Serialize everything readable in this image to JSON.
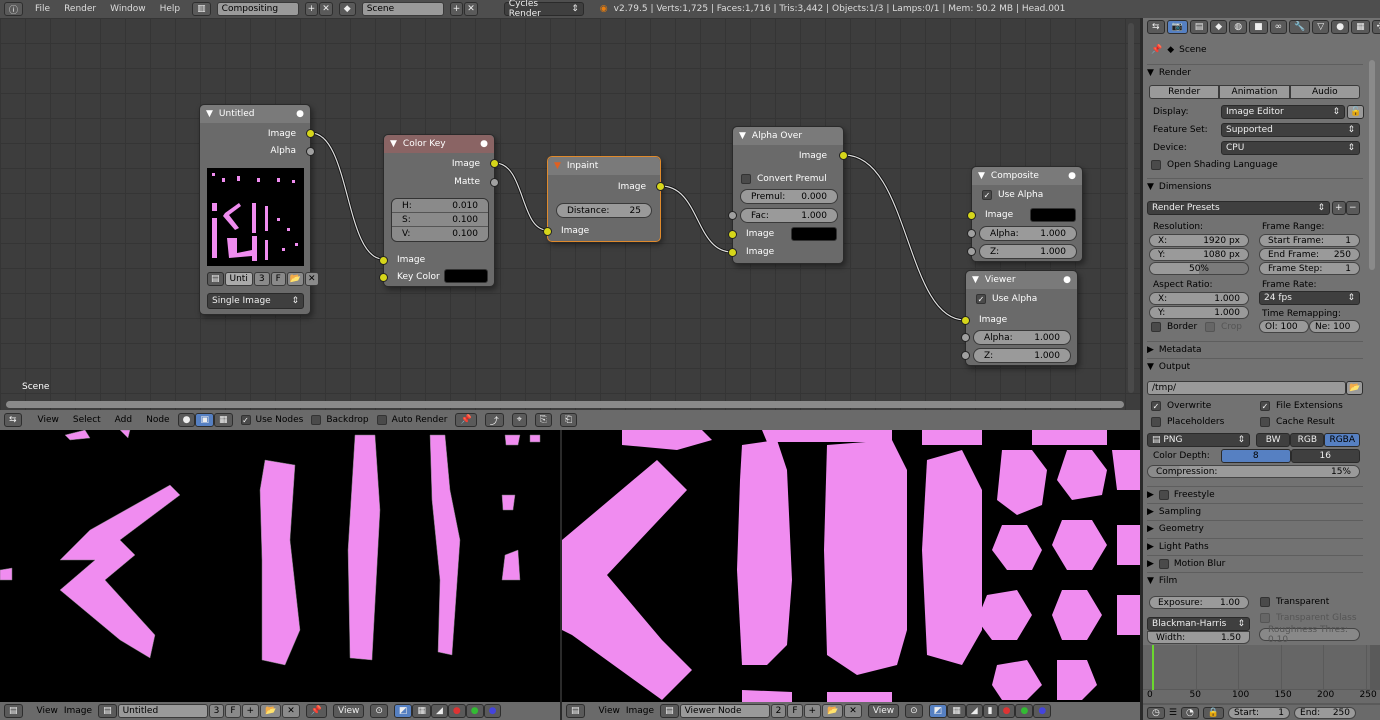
{
  "topbar": {
    "menus": [
      "File",
      "Render",
      "Window",
      "Help"
    ],
    "screen": "Compositing",
    "scene": "Scene",
    "engine": "Cycles Render",
    "stats": "v2.79.5 | Verts:1,725 | Faces:1,716 | Tris:3,442 | Objects:1/3 | Lamps:0/1 | Mem: 50.2 MB | Head.001"
  },
  "node_editor": {
    "scene_label": "Scene",
    "nodes": {
      "image": {
        "title": "Untitled",
        "out_image": "Image",
        "out_alpha": "Alpha",
        "image_name": "Unti",
        "users": "3",
        "fake": "F",
        "source": "Single Image"
      },
      "color_key": {
        "title": "Color Key",
        "out_image": "Image",
        "out_matte": "Matte",
        "h_label": "H:",
        "h": "0.010",
        "s_label": "S:",
        "s": "0.100",
        "v_label": "V:",
        "v": "0.100",
        "in_image": "Image",
        "in_key": "Key Color",
        "key_color": "#000000",
        "header_color": "#8a6464"
      },
      "inpaint": {
        "title": "Inpaint",
        "out_image": "Image",
        "distance_label": "Distance:",
        "distance": "25",
        "in_image": "Image",
        "border_color": "#e08a2c"
      },
      "alpha_over": {
        "title": "Alpha Over",
        "out_image": "Image",
        "convert_premul": "Convert Premul",
        "premul_label": "Premul:",
        "premul": "0.000",
        "fac_label": "Fac:",
        "fac": "1.000",
        "in_image1": "Image",
        "in_image2": "Image"
      },
      "composite": {
        "title": "Composite",
        "use_alpha": "Use Alpha",
        "in_image": "Image",
        "alpha_label": "Alpha:",
        "alpha": "1.000",
        "z_label": "Z:",
        "z": "1.000"
      },
      "viewer": {
        "title": "Viewer",
        "use_alpha": "Use Alpha",
        "in_image": "Image",
        "alpha_label": "Alpha:",
        "alpha": "1.000",
        "z_label": "Z:",
        "z": "1.000"
      }
    }
  },
  "node_header": {
    "menus": [
      "View",
      "Select",
      "Add",
      "Node"
    ],
    "use_nodes": "Use Nodes",
    "backdrop": "Backdrop",
    "auto_render": "Auto Render"
  },
  "image_left": {
    "menus": [
      "View",
      "Image"
    ],
    "image": "Untitled",
    "users": "3",
    "fake": "F",
    "view": "View"
  },
  "image_right": {
    "menus": [
      "View",
      "Image"
    ],
    "image": "Viewer Node",
    "users": "2",
    "fake": "F",
    "view": "View"
  },
  "properties": {
    "context": "Scene",
    "render": {
      "title": "Render",
      "render_btn": "Render",
      "animation_btn": "Animation",
      "audio_btn": "Audio",
      "display_label": "Display:",
      "display": "Image Editor",
      "feature_label": "Feature Set:",
      "feature": "Supported",
      "device_label": "Device:",
      "device": "CPU",
      "osl": "Open Shading Language"
    },
    "dimensions": {
      "title": "Dimensions",
      "presets": "Render Presets",
      "resolution": "Resolution:",
      "x_label": "X:",
      "x": "1920 px",
      "y_label": "Y:",
      "y": "1080 px",
      "percent": "50%",
      "frame_range": "Frame Range:",
      "start_label": "Start Frame:",
      "start": "1",
      "end_label": "End Frame:",
      "end": "250",
      "step_label": "Frame Step:",
      "step": "1",
      "aspect": "Aspect Ratio:",
      "ax": "1.000",
      "ay": "1.000",
      "frame_rate": "Frame Rate:",
      "fps": "24 fps",
      "time_remap": "Time Remapping:",
      "old": "Ol: 100",
      "new": "Ne: 100",
      "border": "Border",
      "crop": "Crop"
    },
    "metadata": "Metadata",
    "output": {
      "title": "Output",
      "path": "/tmp/",
      "overwrite": "Overwrite",
      "file_ext": "File Extensions",
      "placeholders": "Placeholders",
      "cache": "Cache Result",
      "format": "PNG",
      "bw": "BW",
      "rgb": "RGB",
      "rgba": "RGBA",
      "depth_label": "Color Depth:",
      "d8": "8",
      "d16": "16",
      "compression_label": "Compression:",
      "compression": "15%"
    },
    "collapsed": [
      "Freestyle",
      "Sampling",
      "Geometry",
      "Light Paths",
      "Motion Blur"
    ],
    "film": {
      "title": "Film",
      "exposure_label": "Exposure:",
      "exposure": "1.00",
      "transparent": "Transparent",
      "transparent_glass": "Transparent Glass",
      "filter": "Blackman-Harris",
      "width_label": "Width:",
      "width": "1.50",
      "roughness": "Roughness Thres: 0.10"
    }
  },
  "timeline": {
    "ticks": [
      "0",
      "50",
      "100",
      "150",
      "200",
      "250"
    ],
    "start_label": "Start:",
    "start": "1",
    "end_label": "End:",
    "end": "250",
    "current_frame": 1
  },
  "colors": {
    "accent": "#5680c2",
    "uv_pink": "#f08cf0",
    "socket_yellow": "#d6d61a"
  }
}
